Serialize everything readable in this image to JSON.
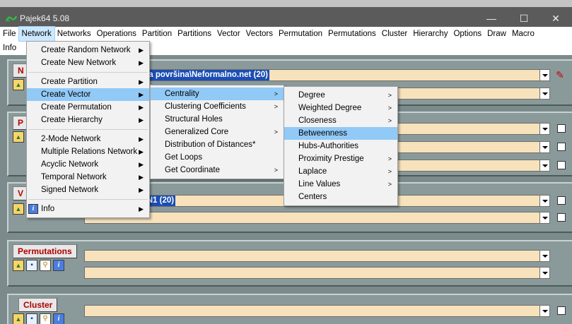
{
  "window": {
    "title": "Pajek64 5.08",
    "minimize": "—",
    "maximize": "☐",
    "close": "✕",
    "accent": "#5b5b5b"
  },
  "menubar": {
    "row1": [
      "File",
      "Network",
      "Networks",
      "Operations",
      "Partition",
      "Partitions",
      "Vector",
      "Vectors",
      "Permutation",
      "Permutations",
      "Cluster",
      "Hierarchy",
      "Options",
      "Draw",
      "Macro"
    ],
    "row2": [
      "Info"
    ],
    "active": "Network"
  },
  "panels": {
    "networks": {
      "tab": "N",
      "value": "\\OneDrive\\Radna površina\\Neformalno.net (20)"
    },
    "partitions": {
      "tab": "P"
    },
    "vectors": {
      "tab": "V",
      "value": "ss centrality in N1 (20)"
    },
    "permutations": {
      "tab": "Permutations"
    },
    "cluster": {
      "tab": "Cluster"
    }
  },
  "network_menu": {
    "group1": [
      {
        "label": "Create Random Network",
        "submenu": true
      },
      {
        "label": "Create New Network",
        "submenu": true
      }
    ],
    "group2": [
      {
        "label": "Create Partition",
        "submenu": true
      },
      {
        "label": "Create Vector",
        "submenu": true,
        "highlighted": true
      },
      {
        "label": "Create Permutation",
        "submenu": true
      },
      {
        "label": "Create Hierarchy",
        "submenu": true
      }
    ],
    "group3": [
      {
        "label": "2-Mode Network",
        "submenu": true
      },
      {
        "label": "Multiple Relations Network",
        "submenu": true
      },
      {
        "label": "Acyclic Network",
        "submenu": true
      },
      {
        "label": "Temporal Network",
        "submenu": true
      },
      {
        "label": "Signed Network",
        "submenu": true
      }
    ],
    "group4": [
      {
        "label": "Info",
        "submenu": true
      }
    ]
  },
  "create_vector_menu": [
    {
      "label": "Centrality",
      "submenu": true,
      "highlighted": true
    },
    {
      "label": "Clustering Coefficients",
      "submenu": true
    },
    {
      "label": "Structural Holes",
      "submenu": false
    },
    {
      "label": "Generalized Core",
      "submenu": true
    },
    {
      "label": "Distribution of Distances*",
      "submenu": false
    },
    {
      "label": "Get Loops",
      "submenu": false
    },
    {
      "label": "Get Coordinate",
      "submenu": true
    }
  ],
  "centrality_menu": [
    {
      "label": "Degree",
      "submenu": true
    },
    {
      "label": "Weighted Degree",
      "submenu": true
    },
    {
      "label": "Closeness",
      "submenu": true
    },
    {
      "label": "Betweenness",
      "submenu": false,
      "highlighted": true
    },
    {
      "label": "Hubs-Authorities",
      "submenu": false
    },
    {
      "label": "Proximity Prestige",
      "submenu": true
    },
    {
      "label": "Laplace",
      "submenu": true
    },
    {
      "label": "Line Values",
      "submenu": true
    },
    {
      "label": "Centers",
      "submenu": false
    }
  ],
  "colors": {
    "combo_bg": "#f7e2bc",
    "selection": "#1b4db3",
    "tab_text": "#b00000",
    "menu_highlight": "#91c9f7"
  }
}
